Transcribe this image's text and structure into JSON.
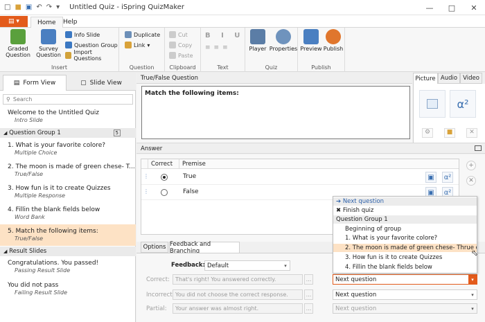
{
  "window": {
    "title": "Untitled Quiz - iSpring QuizMaker"
  },
  "ribbon_tabs": {
    "file": "▤ ▾",
    "home": "Home",
    "help": "Help"
  },
  "ribbon": {
    "insert": {
      "graded": "Graded Question",
      "survey": "Survey Question",
      "info_slide": "Info Slide",
      "question_group": "Question Group",
      "import": "Import Questions",
      "label": "Insert"
    },
    "question": {
      "duplicate": "Duplicate",
      "link": "Link",
      "label": "Question"
    },
    "clipboard": {
      "cut": "Cut",
      "copy": "Copy",
      "paste": "Paste",
      "label": "Clipboard"
    },
    "text": {
      "label": "Text"
    },
    "quiz": {
      "player": "Player",
      "properties": "Properties",
      "label": "Quiz"
    },
    "publish": {
      "preview": "Preview",
      "publish": "Publish",
      "label": "Publish"
    }
  },
  "left_panel": {
    "form_view": "Form View",
    "slide_view": "Slide View",
    "search_placeholder": "Search",
    "intro": {
      "title": "Welcome to the Untitled Quiz",
      "type": "Intro Slide"
    },
    "group1": {
      "name": "Question Group 1",
      "count": "5"
    },
    "questions": [
      {
        "title": "1. What is your favorite colore?",
        "type": "Multiple Choice"
      },
      {
        "title": "2. The moon is made of green chese- T...",
        "type": "True/False"
      },
      {
        "title": "3. How fun is it to create Quizzes",
        "type": "Multiple Response"
      },
      {
        "title": "4. Fillin the blank fields below",
        "type": "Word Bank"
      },
      {
        "title": "5. Match the following items:",
        "type": "True/False"
      }
    ],
    "result_group": "Result Slides",
    "results": [
      {
        "title": "Congratulations. You passed!",
        "type": "Passing Result Slide"
      },
      {
        "title": "You did not pass",
        "type": "Failing Result Slide"
      }
    ]
  },
  "question": {
    "type_header": "True/False Question",
    "text": "Match the following items:"
  },
  "media_tabs": {
    "picture": "Picture",
    "audio": "Audio",
    "video": "Video",
    "alpha": "α²"
  },
  "answer": {
    "header": "Answer",
    "col_correct": "Correct",
    "col_premise": "Premise",
    "rows": [
      {
        "premise": "True",
        "correct": true
      },
      {
        "premise": "False",
        "correct": false
      }
    ]
  },
  "bottom_tabs": {
    "options": "Options",
    "feedback": "Feedback and Branching"
  },
  "feedback": {
    "feedback_label": "Feedback:",
    "feedback_value": "Default",
    "correct_label": "Correct:",
    "correct_text": "That's right! You answered correctly.",
    "incorrect_label": "Incorrect:",
    "incorrect_text": "You did not choose the correct response.",
    "partial_label": "Partial:",
    "partial_text": "Your answer was almost right.",
    "dots": "...",
    "branch_correct": "Next question",
    "branch_incorrect": "Next question",
    "branch_partial": "Next question"
  },
  "branch_popup": {
    "items": [
      {
        "label": "➔ Next question",
        "kind": "group"
      },
      {
        "label": "✖ Finish quiz",
        "kind": "item"
      },
      {
        "label": "Question Group 1",
        "kind": "group"
      },
      {
        "label": "Beginning of group",
        "kind": "indent"
      },
      {
        "label": "1. What is your favorite colore?",
        "kind": "indent"
      },
      {
        "label": "2. The moon is made of green chese- Thrue or Fa",
        "kind": "highlight"
      },
      {
        "label": "3. How fun is it to create Quizzes",
        "kind": "indent"
      },
      {
        "label": "4. Fillin the blank fields below",
        "kind": "indent"
      }
    ]
  },
  "colors": {
    "accent": "#e35b1b",
    "selection": "#fde2c5"
  }
}
